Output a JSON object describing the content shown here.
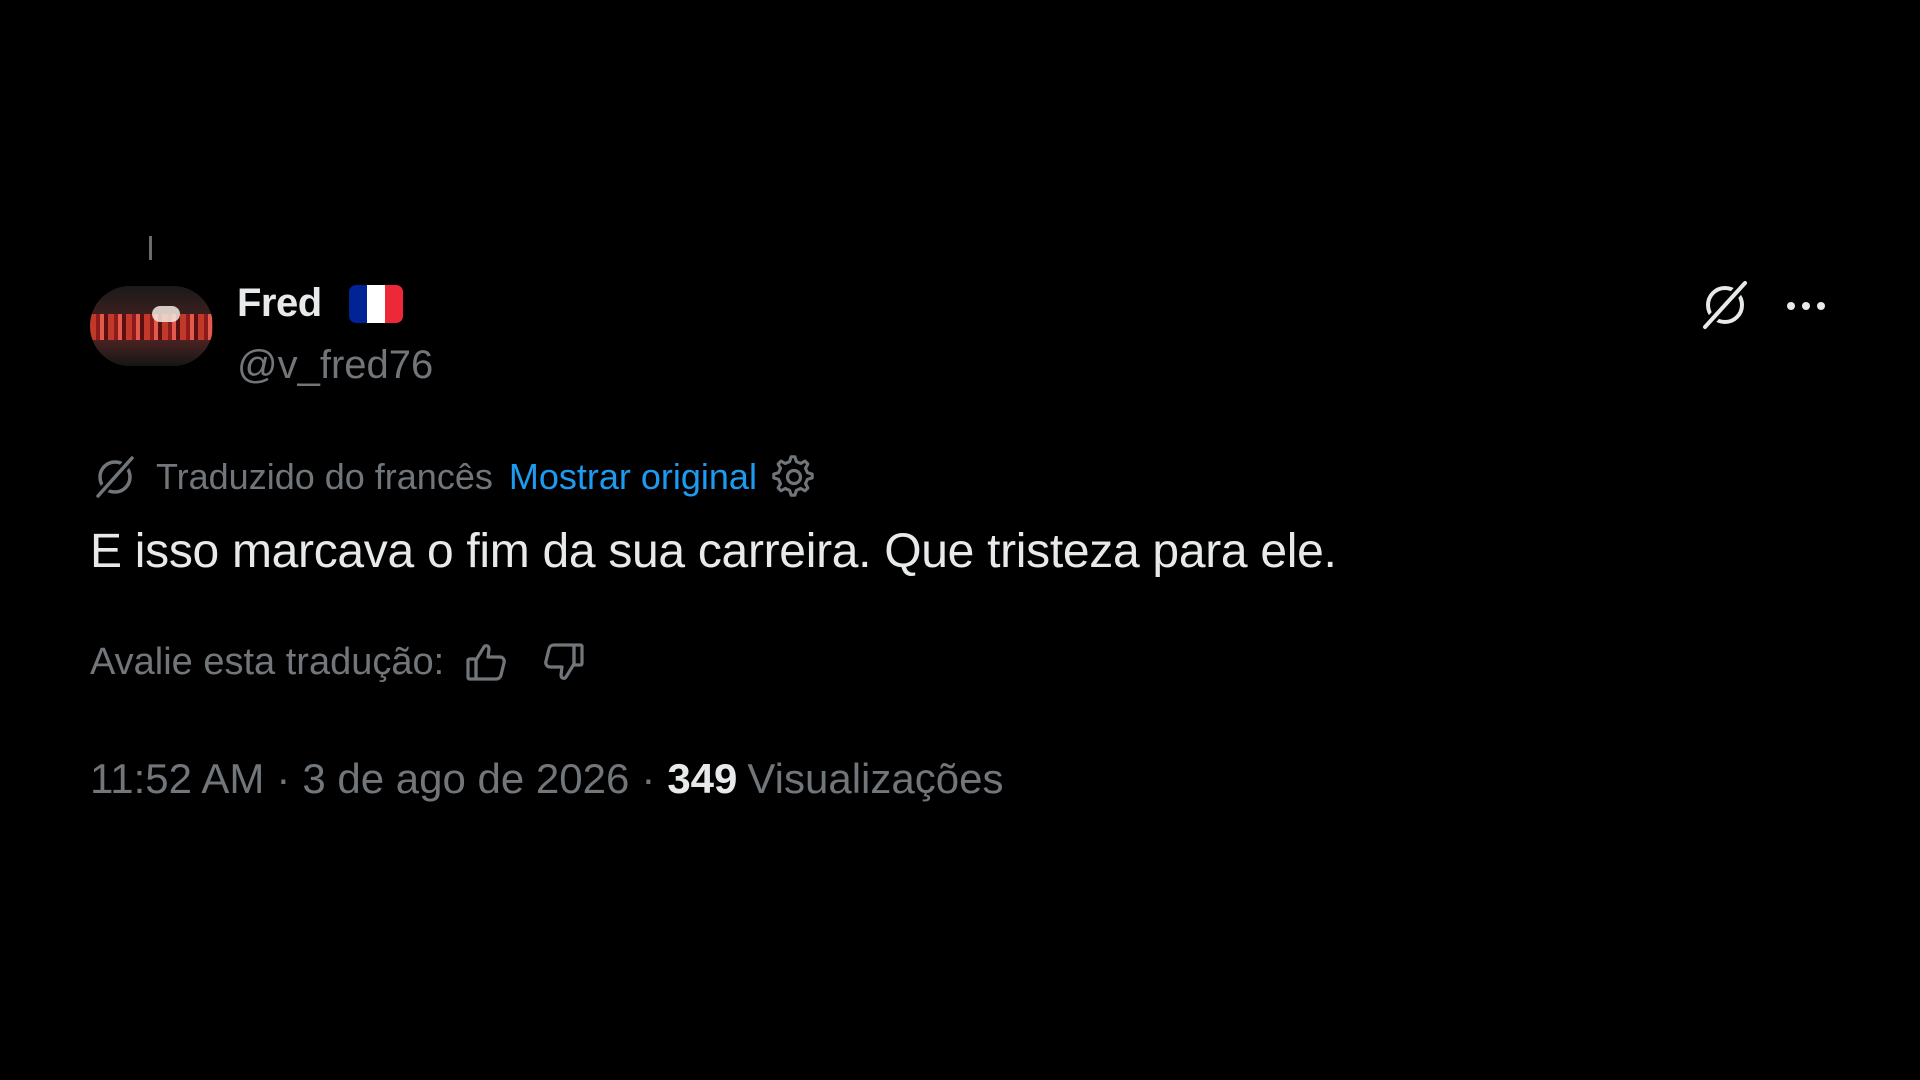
{
  "author": {
    "display_name": "Fred",
    "flag": "france-flag",
    "handle": "@v_fred76"
  },
  "header_actions": {
    "grok_icon": "grok-icon",
    "more_icon": "more-icon"
  },
  "translation": {
    "icon": "grok-icon",
    "label": "Traduzido do francês",
    "show_original": "Mostrar original",
    "settings_icon": "gear-icon"
  },
  "tweet": {
    "text": "E isso marcava o fim da sua carreira. Que tristeza para ele."
  },
  "rating": {
    "label": "Avalie esta tradução:",
    "up_icon": "thumbs-up-icon",
    "down_icon": "thumbs-down-icon"
  },
  "meta": {
    "time": "11:52 AM",
    "separator": "·",
    "date": "3 de ago de 2026",
    "views_count": "349",
    "views_label": "Visualizações"
  },
  "colors": {
    "background": "#000000",
    "primary_text": "#e7e9ea",
    "secondary_text": "#71767b",
    "link": "#1d9bf0",
    "flag_blue": "#002395",
    "flag_white": "#ffffff",
    "flag_red": "#ed2939"
  }
}
